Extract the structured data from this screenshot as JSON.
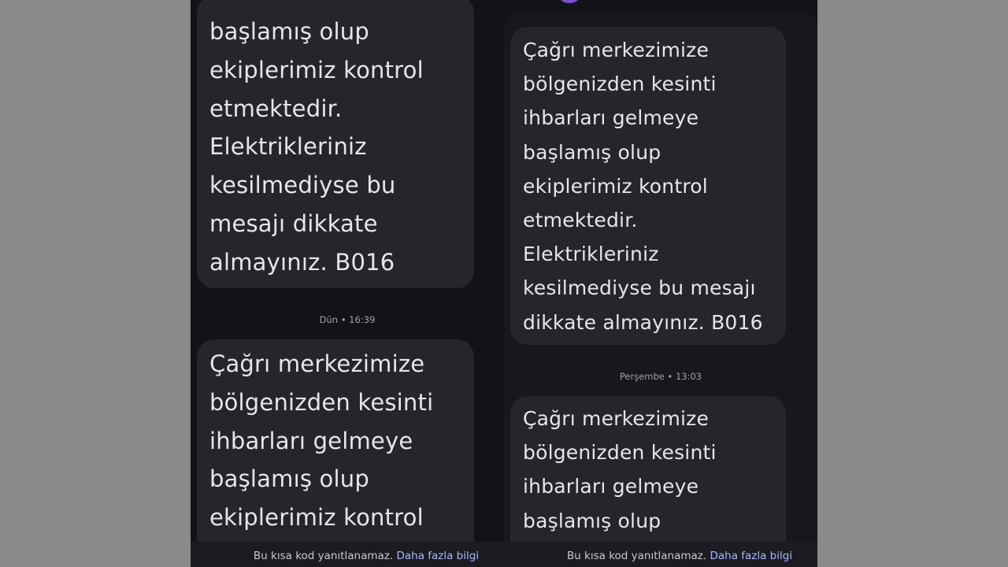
{
  "left_panel": {
    "message_top": "başlamış olup\nekiplerimiz kontrol\netmektedir.\nElektrikleriniz\nkesilmediyse bu\nmesajı dikkate\nalmayınız. B016",
    "timestamp": "Dün • 16:39",
    "message_bottom": "Çağrı merkezimize\nbölgenizden kesinti\nihbarları gelmeye\nbaşlamış olup\nekiplerimiz kontrol",
    "footer_text": "Bu kısa kod yanıtlanamaz.",
    "footer_link": "Daha fazla bilgi"
  },
  "right_panel": {
    "message_top": "Çağrı merkezimize\nbölgenizden kesinti\nihbarları gelmeye\nbaşlamış olup\nekiplerimiz kontrol\netmektedir.\nElektrikleriniz\nkesilmediyse bu mesajı\ndikkate almayınız. B016",
    "timestamp": "Perşembe • 13:03",
    "message_bottom": "Çağrı merkezimize\nbölgenizden kesinti\nihbarları gelmeye\nbaşlamış olup",
    "footer_text": "Bu kısa kod yanıtlanamaz.",
    "footer_link": "Daha fazla bilgi"
  },
  "icons": {
    "scroll_down": "arrow-down-icon"
  },
  "colors": {
    "bubble": "#25262c",
    "background": "#121317",
    "link": "#a9b6ff",
    "avatar": "#7c4fd0"
  }
}
